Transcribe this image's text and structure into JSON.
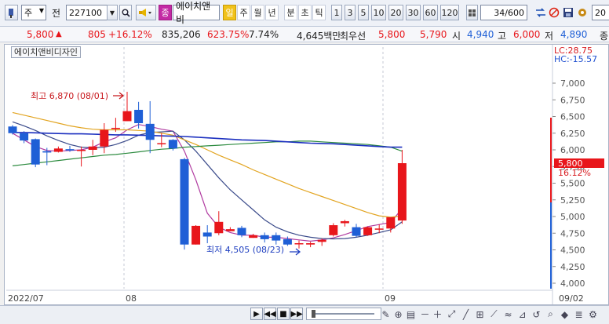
{
  "toolbar": {
    "market_select": "주",
    "period_label": "전",
    "code_value": "227100",
    "stock_badge": "종",
    "stock_name": "에이치앤비",
    "period_tabs": [
      "일",
      "주",
      "월",
      "년",
      "분",
      "초",
      "틱"
    ],
    "interval_buttons": [
      "1",
      "3",
      "5",
      "10",
      "20",
      "30",
      "60",
      "120"
    ],
    "count_value": "34",
    "count_total": "/600",
    "right_cut": "20"
  },
  "quote": {
    "price": "5,800",
    "arrow": "▲",
    "change": "805",
    "change_pct": "+16.12%",
    "volume": "835,206",
    "volume_pct": "623.75%",
    "turnover": "7.74%",
    "amount": "4,645백만",
    "best_label": "최우선",
    "best_ask": "5,800",
    "best_bid": "5,790",
    "open_label": "시",
    "open": "4,940",
    "high_label": "고",
    "high": "6,000",
    "low_label": "저",
    "low": "4,890",
    "extra": "종"
  },
  "chart": {
    "ticker_tag": "에이치앤비디자인",
    "lc_label": "LC:28.75",
    "hc_label": "HC:-15.57",
    "price_box": "5,800",
    "pct_box": "16.12%",
    "high_annotation": "최고 6,870 (08/01)",
    "low_annotation": "최저 4,505 (08/23)",
    "dates": [
      "2022/07",
      "08",
      "09",
      "09/02"
    ]
  },
  "chart_data": {
    "type": "candlestick",
    "ylim": [
      3900,
      7150
    ],
    "y_ticks": [
      "7,000",
      "6,750",
      "6,500",
      "6,250",
      "6,000",
      "5,750",
      "5,500",
      "5,250",
      "5,000",
      "4,750",
      "4,500",
      "4,250",
      "4,000"
    ],
    "y_tick_values": [
      7000,
      6750,
      6500,
      6250,
      6000,
      5750,
      5500,
      5250,
      5000,
      4750,
      4500,
      4250,
      4000
    ],
    "candles": [
      [
        6350,
        6370,
        6230,
        6250
      ],
      [
        6250,
        6280,
        6100,
        6140
      ],
      [
        6160,
        6170,
        5740,
        5780
      ],
      [
        5980,
        6030,
        5770,
        5960
      ],
      [
        5970,
        6050,
        5960,
        6020
      ],
      [
        6010,
        6060,
        5970,
        5990
      ],
      [
        5990,
        6050,
        5750,
        6000
      ],
      [
        6000,
        6150,
        5920,
        6050
      ],
      [
        6050,
        6400,
        5950,
        6300
      ],
      [
        6320,
        6480,
        6270,
        6330
      ],
      [
        6430,
        6870,
        6430,
        6580
      ],
      [
        6600,
        6720,
        6320,
        6400
      ],
      [
        6390,
        6730,
        5950,
        6150
      ],
      [
        6100,
        6250,
        6040,
        6100
      ],
      [
        6150,
        6160,
        5990,
        6020
      ],
      [
        5860,
        5880,
        4505,
        4580
      ],
      [
        4580,
        4870,
        4580,
        4860
      ],
      [
        4760,
        4870,
        4600,
        4700
      ],
      [
        4750,
        5080,
        4720,
        4920
      ],
      [
        4780,
        4840,
        4780,
        4810
      ],
      [
        4830,
        4860,
        4690,
        4720
      ],
      [
        4680,
        4740,
        4680,
        4720
      ],
      [
        4720,
        4760,
        4610,
        4660
      ],
      [
        4720,
        4760,
        4580,
        4640
      ],
      [
        4660,
        4700,
        4560,
        4580
      ],
      [
        4600,
        4640,
        4520,
        4600
      ],
      [
        4580,
        4620,
        4540,
        4600
      ],
      [
        4620,
        4670,
        4560,
        4650
      ],
      [
        4720,
        4900,
        4700,
        4870
      ],
      [
        4900,
        4950,
        4850,
        4930
      ],
      [
        4840,
        4890,
        4690,
        4710
      ],
      [
        4720,
        4850,
        4710,
        4840
      ],
      [
        4810,
        4880,
        4750,
        4820
      ],
      [
        4820,
        4990,
        4760,
        4990
      ],
      [
        4940,
        6000,
        4890,
        5800
      ]
    ],
    "ma_lines": [
      {
        "name": "ma5",
        "color": "#b03aa0",
        "values": [
          6250,
          6150,
          6050,
          5990,
          5980,
          5990,
          6000,
          6040,
          6120,
          6180,
          6300,
          6380,
          6350,
          6310,
          6280,
          5980,
          5550,
          5050,
          4840,
          4760,
          4720,
          4720,
          4690,
          4690,
          4670,
          4650,
          4630,
          4650,
          4680,
          4730,
          4790,
          4850,
          4880,
          4910,
          5120
        ]
      },
      {
        "name": "ma10",
        "color": "#3a4a8a",
        "values": [
          6420,
          6360,
          6290,
          6210,
          6140,
          6080,
          6040,
          6030,
          6040,
          6080,
          6140,
          6220,
          6260,
          6270,
          6280,
          6150,
          5980,
          5780,
          5580,
          5400,
          5250,
          5100,
          4950,
          4840,
          4770,
          4720,
          4690,
          4670,
          4665,
          4670,
          4690,
          4720,
          4760,
          4800,
          4920
        ]
      },
      {
        "name": "ma20",
        "color": "#e2a420",
        "values": [
          6560,
          6520,
          6480,
          6440,
          6400,
          6360,
          6330,
          6310,
          6300,
          6300,
          6300,
          6290,
          6280,
          6250,
          6220,
          6150,
          6080,
          6000,
          5920,
          5850,
          5780,
          5700,
          5630,
          5560,
          5490,
          5420,
          5360,
          5300,
          5240,
          5180,
          5120,
          5060,
          5010,
          4990,
          5010
        ]
      },
      {
        "name": "ma60",
        "color": "#2b8a3e",
        "values": [
          5760,
          5780,
          5800,
          5820,
          5840,
          5860,
          5880,
          5900,
          5920,
          5930,
          5950,
          5970,
          5990,
          6010,
          6020,
          6040,
          6050,
          6060,
          6070,
          6080,
          6090,
          6100,
          6110,
          6120,
          6120,
          6130,
          6130,
          6120,
          6110,
          6100,
          6090,
          6080,
          6060,
          6040,
          5980
        ]
      },
      {
        "name": "ma120",
        "color": "#1b2fbf",
        "values": [
          6260,
          6260,
          6255,
          6250,
          6245,
          6240,
          6240,
          6235,
          6230,
          6225,
          6225,
          6220,
          6215,
          6210,
          6205,
          6200,
          6190,
          6180,
          6170,
          6160,
          6150,
          6145,
          6140,
          6130,
          6120,
          6110,
          6100,
          6095,
          6090,
          6080,
          6070,
          6060,
          6050,
          6040,
          6040
        ]
      }
    ],
    "colors": {
      "up": "#e8161b",
      "down": "#1f5fd6"
    }
  }
}
